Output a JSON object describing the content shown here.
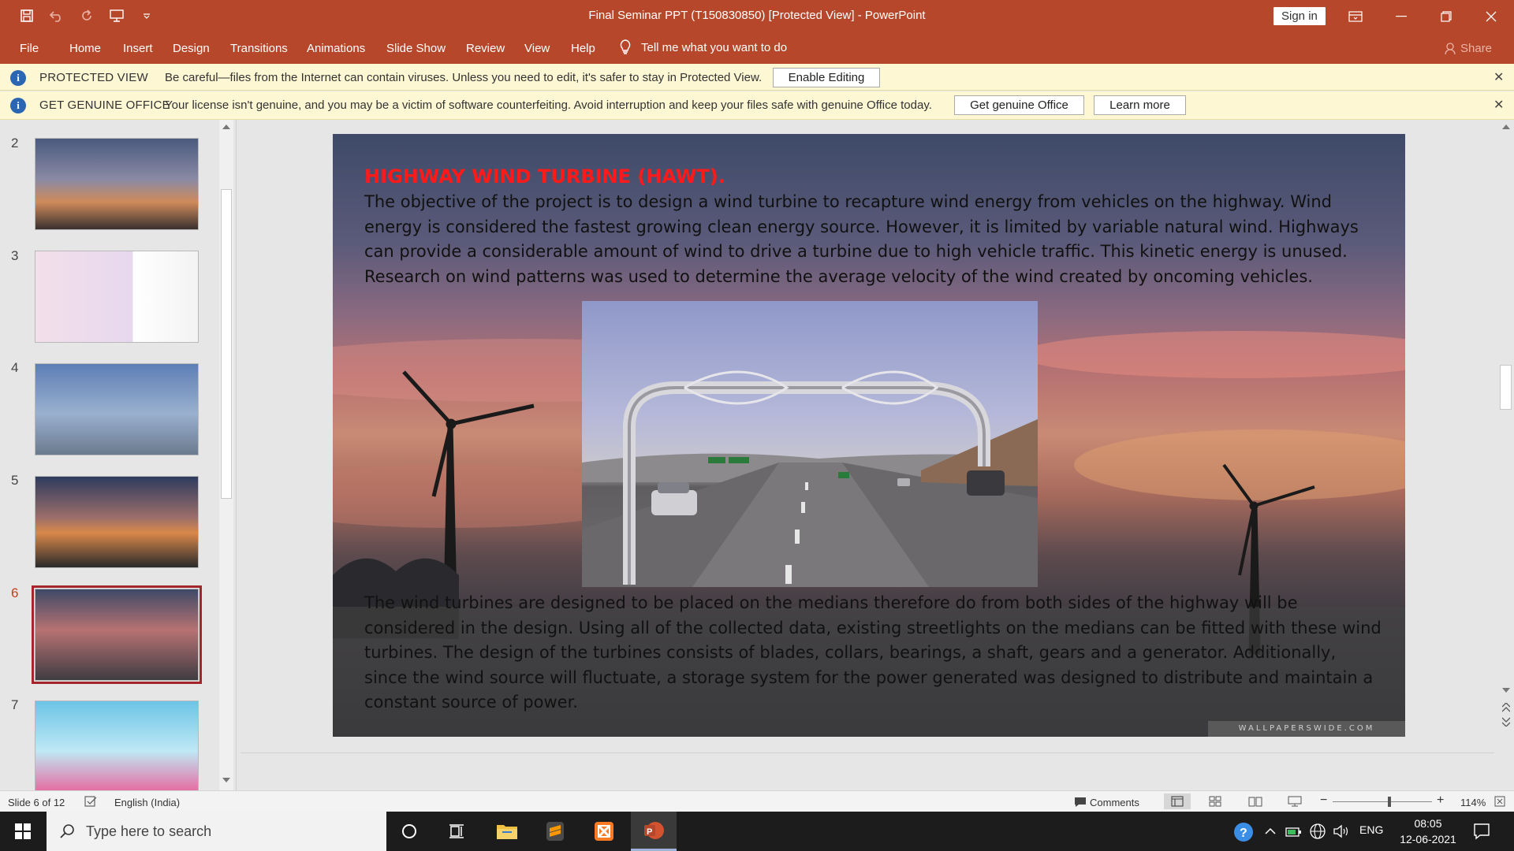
{
  "titlebar": {
    "title": "Final Seminar PPT (T150830850) [Protected View]  -  PowerPoint",
    "signin": "Sign in"
  },
  "ribbon": {
    "tabs": [
      "File",
      "Home",
      "Insert",
      "Design",
      "Transitions",
      "Animations",
      "Slide Show",
      "Review",
      "View",
      "Help"
    ],
    "tellme": "Tell me what you want to do",
    "share": "Share"
  },
  "protected_bar": {
    "title": "PROTECTED VIEW",
    "text": "Be careful—files from the Internet can contain viruses. Unless you need to edit, it's safer to stay in Protected View.",
    "button": "Enable Editing"
  },
  "genuine_bar": {
    "title": "GET GENUINE OFFICE",
    "text": "Your license isn't genuine, and you may be a victim of software counterfeiting. Avoid interruption and keep your files safe with genuine Office today.",
    "button1": "Get genuine Office",
    "button2": "Learn more"
  },
  "thumbnails": {
    "numbers": [
      "2",
      "3",
      "4",
      "5",
      "6",
      "7"
    ],
    "active": "6"
  },
  "slide": {
    "title": "HIGHWAY WIND TURBINE (HAWT).",
    "para1": "The objective of the project is to design a wind turbine to recapture wind energy from vehicles on the highway. Wind energy is considered the fastest growing clean energy source. However, it is limited by variable natural wind. Highways can provide a considerable amount of wind to drive a turbine due to high vehicle traffic. This kinetic energy is unused. Research on wind patterns was used to determine the average velocity of the wind created by oncoming vehicles.",
    "para2": " The wind turbines are designed to be placed on the medians therefore do  from both sides of the highway will be considered in the design. Using all of the collected data, existing streetlights on the medians can be fitted with these wind turbines. The design of the turbines consists of blades, collars, bearings, a shaft, gears and a generator. Additionally, since the wind source will fluctuate, a storage system for the power generated was designed to distribute and maintain a constant source of power.",
    "watermark": "WALLPAPERSWIDE.COM"
  },
  "statusbar": {
    "slide_count": "Slide 6 of 12",
    "language": "English (India)",
    "comments": "Comments",
    "zoom": "114%",
    "zoom_level": 0.57
  },
  "taskbar": {
    "search_placeholder": "Type here to search",
    "lang": "ENG",
    "time": "08:05",
    "date": "12-06-2021"
  },
  "colors": {
    "accent": "#b7472a",
    "message_bar": "#fdf7d3",
    "slide_title": "#ff1a1a"
  }
}
